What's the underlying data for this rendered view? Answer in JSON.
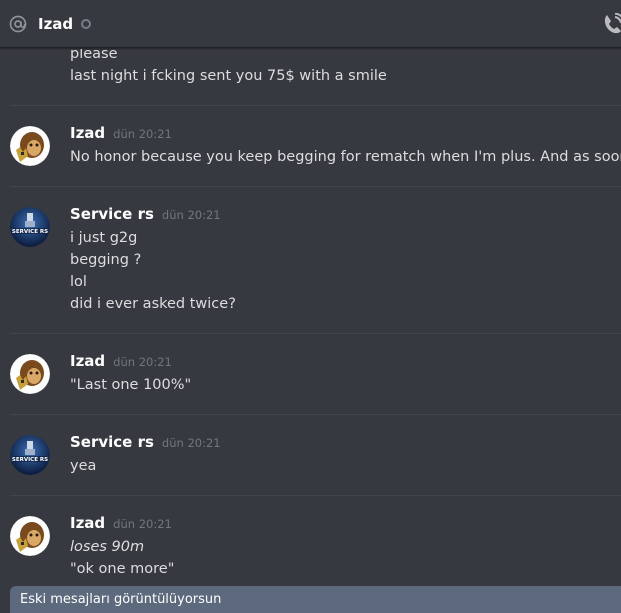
{
  "header": {
    "title": "Izad",
    "status": "offline"
  },
  "top_lines": [
    "please",
    "last night i fcking sent you 75$ with a smile"
  ],
  "groups": [
    {
      "author": "Izad",
      "timestamp": "dün 20:21",
      "avatar": "bape-ape-avatar",
      "lines": [
        "No honor because you keep begging for rematch when I'm plus. And as soon as you go pl"
      ]
    },
    {
      "author": "Service rs",
      "timestamp": "dün 20:21",
      "avatar": "service-rs-avatar",
      "lines": [
        "i just g2g",
        "begging ?",
        "lol",
        "did i ever asked twice?"
      ]
    },
    {
      "author": "Izad",
      "timestamp": "dün 20:21",
      "avatar": "bape-ape-avatar",
      "lines": [
        "\"Last one 100%\""
      ]
    },
    {
      "author": "Service rs",
      "timestamp": "dün 20:21",
      "avatar": "service-rs-avatar",
      "lines": [
        "yea"
      ]
    },
    {
      "author": "Izad",
      "timestamp": "dün 20:21",
      "avatar": "bape-ape-avatar",
      "lines": [
        "loses 90m",
        "\"ok one more\""
      ]
    }
  ],
  "service_avatar_text": "SERVICE RS",
  "old_messages_bar": "Eski mesajları görüntülüyorsun",
  "colors": {
    "background": "#36393f",
    "text": "#dcddde",
    "author": "#ffffff",
    "timestamp": "#72767d",
    "old_bar": "#5d6a7e"
  }
}
